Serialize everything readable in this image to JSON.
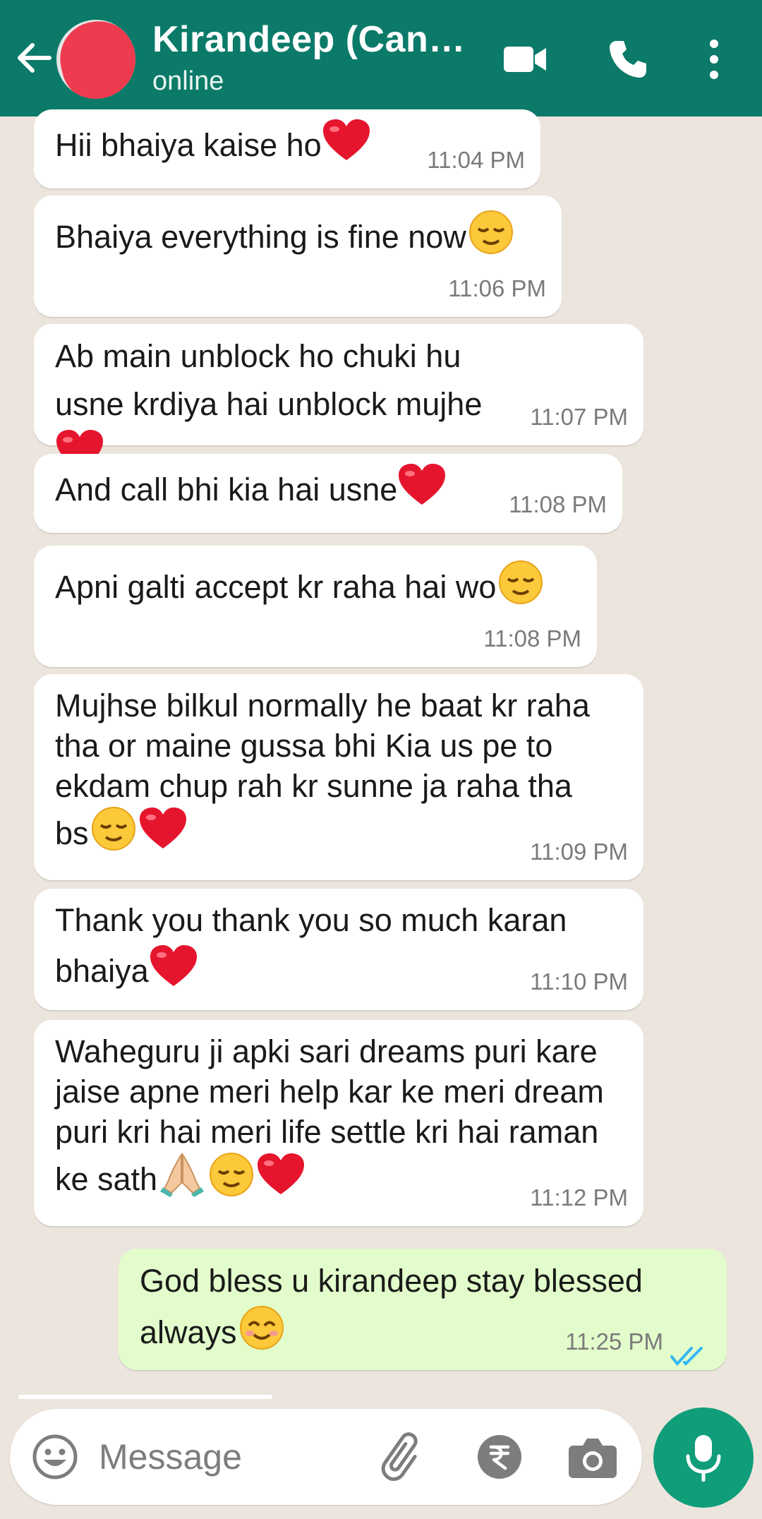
{
  "header": {
    "name": "Kirandeep (Cana...",
    "status": "online"
  },
  "messages": [
    {
      "text": "Hii bhaiya kaise ho",
      "emojis": [
        "red-heart"
      ],
      "time": "11:04 PM",
      "direction": "in"
    },
    {
      "text": "Bhaiya everything is fine now",
      "emojis": [
        "relieved-face"
      ],
      "time": "11:06 PM",
      "direction": "in"
    },
    {
      "text": "Ab main unblock ho chuki hu usne krdiya hai unblock mujhe",
      "emojis": [
        "red-heart"
      ],
      "time": "11:07 PM",
      "direction": "in"
    },
    {
      "text": "And call bhi kia hai usne",
      "emojis": [
        "red-heart"
      ],
      "time": "11:08 PM",
      "direction": "in"
    },
    {
      "text": "Apni galti accept kr raha hai wo",
      "emojis": [
        "relieved-face"
      ],
      "time": "11:08 PM",
      "direction": "in"
    },
    {
      "text": "Mujhse bilkul normally he baat kr raha tha or maine gussa bhi Kia us pe to ekdam chup rah kr sunne ja raha tha bs",
      "emojis": [
        "relieved-face",
        "red-heart"
      ],
      "time": "11:09 PM",
      "direction": "in"
    },
    {
      "text": "Thank you thank you so much karan bhaiya",
      "emojis": [
        "red-heart"
      ],
      "time": "11:10 PM",
      "direction": "in"
    },
    {
      "text": "Waheguru ji apki sari dreams puri kare jaise apne meri help kar ke meri dream puri kri hai meri life settle kri hai raman ke sath",
      "emojis": [
        "folded-hands",
        "relieved-face",
        "red-heart"
      ],
      "time": "11:12 PM",
      "direction": "in"
    },
    {
      "text": "God bless u kirandeep stay blessed always",
      "emojis": [
        "smiling-face"
      ],
      "time": "11:25 PM",
      "direction": "out",
      "status": "read"
    }
  ],
  "composer": {
    "placeholder": "Message"
  },
  "colors": {
    "header": "#0B7A69",
    "chat_background": "#ECE5DD",
    "incoming_bubble": "#FFFFFF",
    "outgoing_bubble": "#E2FDCB",
    "read_ticks": "#34B7F1",
    "mic_button": "#0F9D7A"
  },
  "icons": [
    "back-arrow-icon",
    "video-call-icon",
    "voice-call-icon",
    "more-options-icon",
    "emoji-icon",
    "attach-icon",
    "rupee-payment-icon",
    "camera-icon",
    "mic-icon"
  ]
}
